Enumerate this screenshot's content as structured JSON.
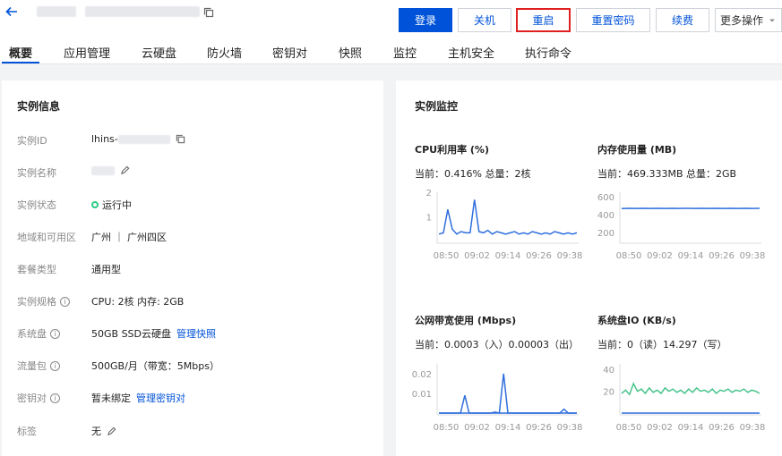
{
  "header": {
    "copy_icon": "copy-icon",
    "back_icon": "arrow-left-icon"
  },
  "toolbar": {
    "login": "登录",
    "shutdown": "关机",
    "restart": "重启",
    "reset_password": "重置密码",
    "renew": "续费",
    "more": "更多操作"
  },
  "tabs": [
    "概要",
    "应用管理",
    "云硬盘",
    "防火墙",
    "密钥对",
    "快照",
    "监控",
    "主机安全",
    "执行命令"
  ],
  "instance_info": {
    "title": "实例信息",
    "rows": [
      {
        "label": "实例ID",
        "value": "lhins-"
      },
      {
        "label": "实例名称",
        "value": ""
      },
      {
        "label": "实例状态",
        "value": "运行中"
      },
      {
        "label": "地域和可用区",
        "value": "广州 ｜ 广州四区"
      },
      {
        "label": "套餐类型",
        "value": "通用型"
      },
      {
        "label": "实例规格",
        "value": "CPU: 2核 内存: 2GB"
      },
      {
        "label": "系统盘",
        "value": "50GB SSD云硬盘",
        "link": "管理快照"
      },
      {
        "label": "流量包",
        "value": "500GB/月（带宽：5Mbps）"
      },
      {
        "label": "密钥对",
        "value": "暂未绑定",
        "link": "管理密钥对"
      },
      {
        "label": "标签",
        "value": "无"
      }
    ]
  },
  "monitor": {
    "title": "实例监控",
    "accent": "#2f6fdc",
    "green": "#49c48b"
  },
  "chart_data": [
    {
      "type": "line",
      "title": "CPU利用率 (%)",
      "current": "当前：0.416% 总量：2核",
      "x": [
        "08:50",
        "09:02",
        "09:14",
        "09:26",
        "09:38"
      ],
      "ylim": [
        0,
        2
      ],
      "yticks": [
        1,
        2
      ],
      "series": [
        {
          "values": [
            0.3,
            0.35,
            1.3,
            0.5,
            0.3,
            0.4,
            0.35,
            0.35,
            1.7,
            0.4,
            0.35,
            0.45,
            0.3,
            0.4,
            0.35,
            0.3,
            0.35,
            0.4,
            0.3,
            0.35,
            0.3,
            0.4,
            0.35,
            0.3,
            0.35,
            0.3,
            0.4,
            0.35,
            0.3,
            0.35,
            0.3,
            0.35
          ]
        }
      ]
    },
    {
      "type": "line",
      "title": "内存使用量 (MB)",
      "current": "当前：469.333MB 总量：2GB",
      "x": [
        "08:50",
        "09:02",
        "09:14",
        "09:26",
        "09:38"
      ],
      "ylim": [
        100,
        650
      ],
      "yticks": [
        200,
        400,
        600
      ],
      "series": [
        {
          "values": [
            468,
            470,
            469,
            470,
            469,
            470,
            469,
            470,
            469,
            470,
            469,
            470,
            469,
            470,
            469,
            470,
            469,
            470,
            469,
            470
          ]
        }
      ]
    },
    {
      "type": "line",
      "title": "公网带宽使用 (Mbps)",
      "current": "当前：0.0003（入）0.00003（出）",
      "x": [
        "08:50",
        "09:02",
        "09:14",
        "09:26",
        "09:38"
      ],
      "ylim": [
        0,
        0.025
      ],
      "yticks": [
        0.01,
        0.02
      ],
      "series": [
        {
          "values": [
            0,
            0,
            0,
            0,
            0,
            0,
            0.009,
            0,
            0,
            0,
            0,
            0,
            0,
            0.0005,
            0,
            0.02,
            0,
            0,
            0,
            0,
            0,
            0,
            0,
            0,
            0,
            0,
            0,
            0,
            0,
            0.002,
            0,
            0,
            0
          ]
        },
        {
          "values": [
            0,
            0,
            0,
            0,
            0,
            0,
            0,
            0,
            0,
            0,
            0,
            0,
            0,
            0,
            0,
            0,
            0,
            0,
            0,
            0,
            0,
            0,
            0,
            0,
            0,
            0,
            0,
            0,
            0,
            0,
            0,
            0,
            0
          ]
        }
      ]
    },
    {
      "type": "line",
      "title": "系统盘IO (KB/s)",
      "current": "当前：0（读）14.297（写）",
      "x": [
        "08:50",
        "09:02",
        "09:14",
        "09:26",
        "09:38"
      ],
      "ylim": [
        0,
        45
      ],
      "yticks": [
        20,
        40
      ],
      "series": [
        {
          "values": [
            18,
            21,
            17,
            27,
            20,
            22,
            18,
            23,
            19,
            21,
            18,
            23,
            20,
            22,
            19,
            21,
            18,
            22,
            19,
            23,
            20,
            21,
            19,
            22,
            18,
            21,
            20,
            22,
            19,
            21,
            20,
            22,
            19,
            21,
            20,
            18
          ]
        },
        {
          "values": [
            0,
            0,
            0,
            0,
            0,
            0,
            0,
            0,
            0,
            0,
            0,
            0,
            0,
            0,
            0,
            0,
            0,
            0,
            0,
            0,
            0,
            0,
            0,
            0,
            0,
            0,
            0,
            0,
            0,
            0,
            0,
            0,
            0,
            0,
            0,
            0
          ]
        }
      ]
    }
  ]
}
